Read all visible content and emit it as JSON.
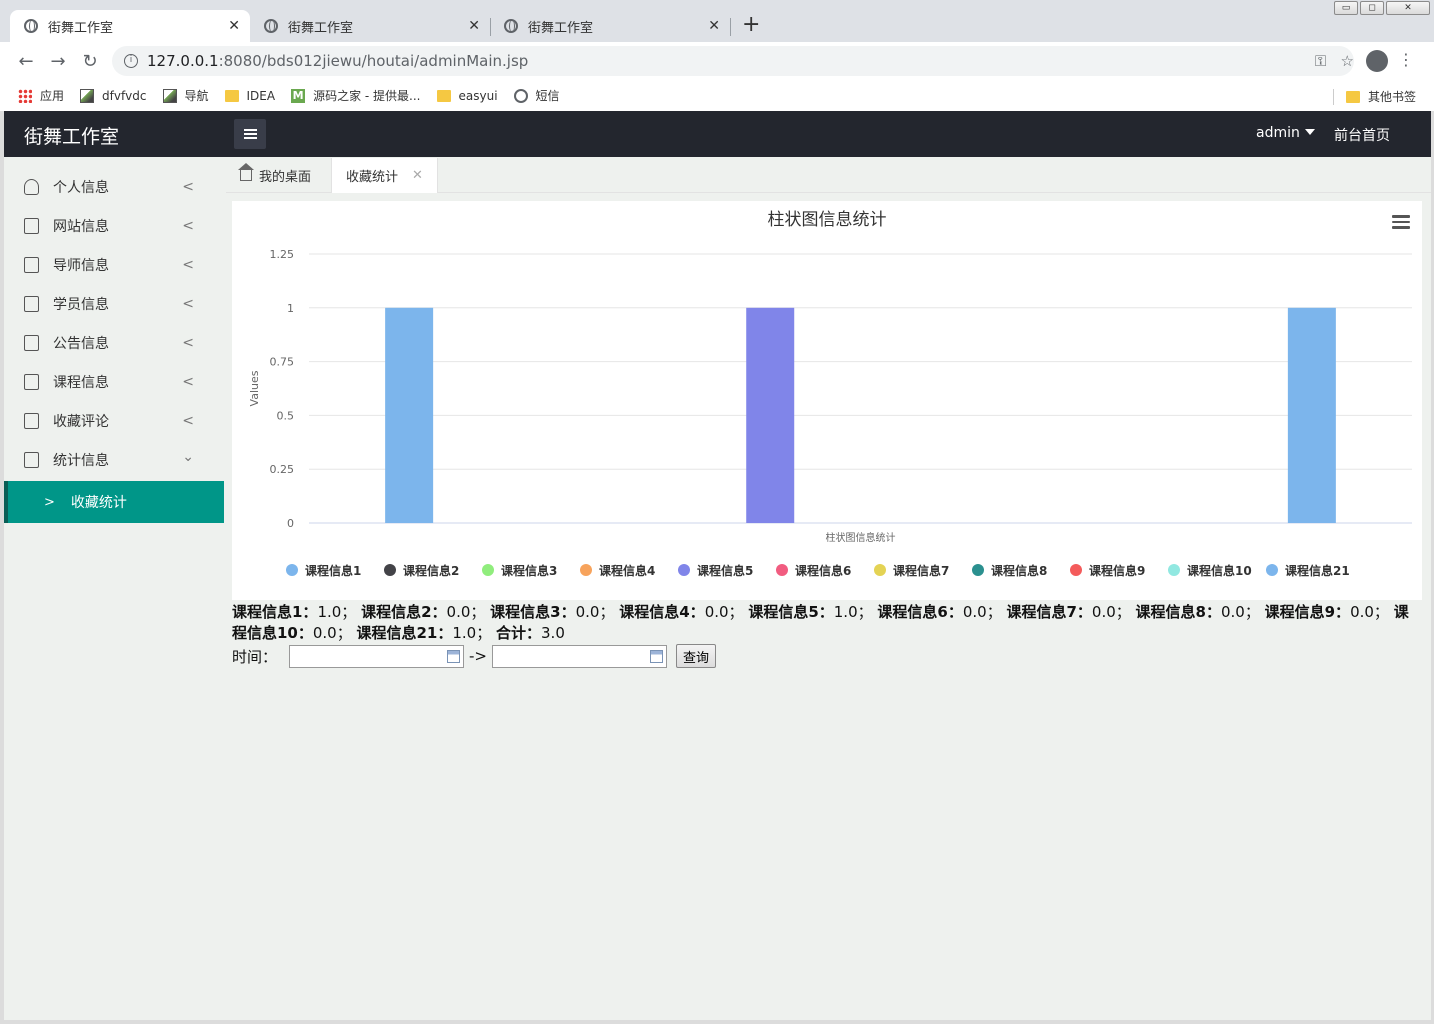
{
  "browser": {
    "tabs": [
      {
        "title": "街舞工作室",
        "active": true
      },
      {
        "title": "街舞工作室",
        "active": false
      },
      {
        "title": "街舞工作室",
        "active": false
      }
    ],
    "url_host": "127.0.0.1",
    "url_rest": ":8080/bds012jiewu/houtai/adminMain.jsp",
    "bookmarks": [
      {
        "label": "应用",
        "icon": "apps-icon"
      },
      {
        "label": "dfvfvdc",
        "icon": "image-icon"
      },
      {
        "label": "导航",
        "icon": "image-icon"
      },
      {
        "label": "IDEA",
        "icon": "folder-icon"
      },
      {
        "label": "源码之家 - 提供最...",
        "icon": "m-icon"
      },
      {
        "label": "easyui",
        "icon": "folder-icon"
      },
      {
        "label": "短信",
        "icon": "globe-icon"
      }
    ],
    "other_bookmarks": "其他书签"
  },
  "header": {
    "logo": "街舞工作室",
    "user": "admin",
    "front_link": "前台首页"
  },
  "sidebar": {
    "items": [
      {
        "label": "个人信息",
        "icon": "user-icon",
        "expanded": false
      },
      {
        "label": "网站信息",
        "icon": "document-icon",
        "expanded": false
      },
      {
        "label": "导师信息",
        "icon": "document-icon",
        "expanded": false
      },
      {
        "label": "学员信息",
        "icon": "document-icon",
        "expanded": false
      },
      {
        "label": "公告信息",
        "icon": "document-icon",
        "expanded": false
      },
      {
        "label": "课程信息",
        "icon": "document-icon",
        "expanded": false
      },
      {
        "label": "收藏评论",
        "icon": "document-icon",
        "expanded": false
      },
      {
        "label": "统计信息",
        "icon": "document-icon",
        "expanded": true
      }
    ],
    "active_sub": "收藏统计"
  },
  "page_tabs": {
    "home": "我的桌面",
    "current": "收藏统计"
  },
  "chart_data": {
    "type": "bar",
    "title": "柱状图信息统计",
    "xlabel": "柱状图信息统计",
    "ylabel": "Values",
    "ylim": [
      0,
      1.25
    ],
    "yticks": [
      "0",
      "0.25",
      "0.5",
      "0.75",
      "1",
      "1.25"
    ],
    "grid": true,
    "legend_position": "bottom",
    "series": [
      {
        "name": "课程信息1",
        "value": 1.0,
        "color": "#7cb5ec"
      },
      {
        "name": "课程信息2",
        "value": 0.0,
        "color": "#434348"
      },
      {
        "name": "课程信息3",
        "value": 0.0,
        "color": "#90ed7d"
      },
      {
        "name": "课程信息4",
        "value": 0.0,
        "color": "#f7a35c"
      },
      {
        "name": "课程信息5",
        "value": 1.0,
        "color": "#8085e9"
      },
      {
        "name": "课程信息6",
        "value": 0.0,
        "color": "#f15c80"
      },
      {
        "name": "课程信息7",
        "value": 0.0,
        "color": "#e4d354"
      },
      {
        "name": "课程信息8",
        "value": 0.0,
        "color": "#2b908f"
      },
      {
        "name": "课程信息9",
        "value": 0.0,
        "color": "#f45b5b"
      },
      {
        "name": "课程信息10",
        "value": 0.0,
        "color": "#91e8e1"
      },
      {
        "name": "课程信息21",
        "value": 1.0,
        "color": "#7cb5ec"
      }
    ]
  },
  "summary": {
    "items": [
      {
        "key": "课程信息1：",
        "value": "1.0；"
      },
      {
        "key": "课程信息2：",
        "value": "0.0；"
      },
      {
        "key": "课程信息3：",
        "value": "0.0；"
      },
      {
        "key": "课程信息4：",
        "value": "0.0；"
      },
      {
        "key": "课程信息5：",
        "value": "1.0；"
      },
      {
        "key": "课程信息6：",
        "value": "0.0；"
      },
      {
        "key": "课程信息7：",
        "value": "0.0；"
      },
      {
        "key": "课程信息8：",
        "value": "0.0；"
      },
      {
        "key": "课程信息9：",
        "value": "0.0；"
      },
      {
        "key": "课程信息10：",
        "value": "0.0；"
      },
      {
        "key": "课程信息21：",
        "value": "1.0；"
      },
      {
        "key": "合计：",
        "value": "3.0"
      }
    ]
  },
  "query": {
    "label": "时间：",
    "start_value": "",
    "end_value": "",
    "separator": "->",
    "button": "查询"
  }
}
